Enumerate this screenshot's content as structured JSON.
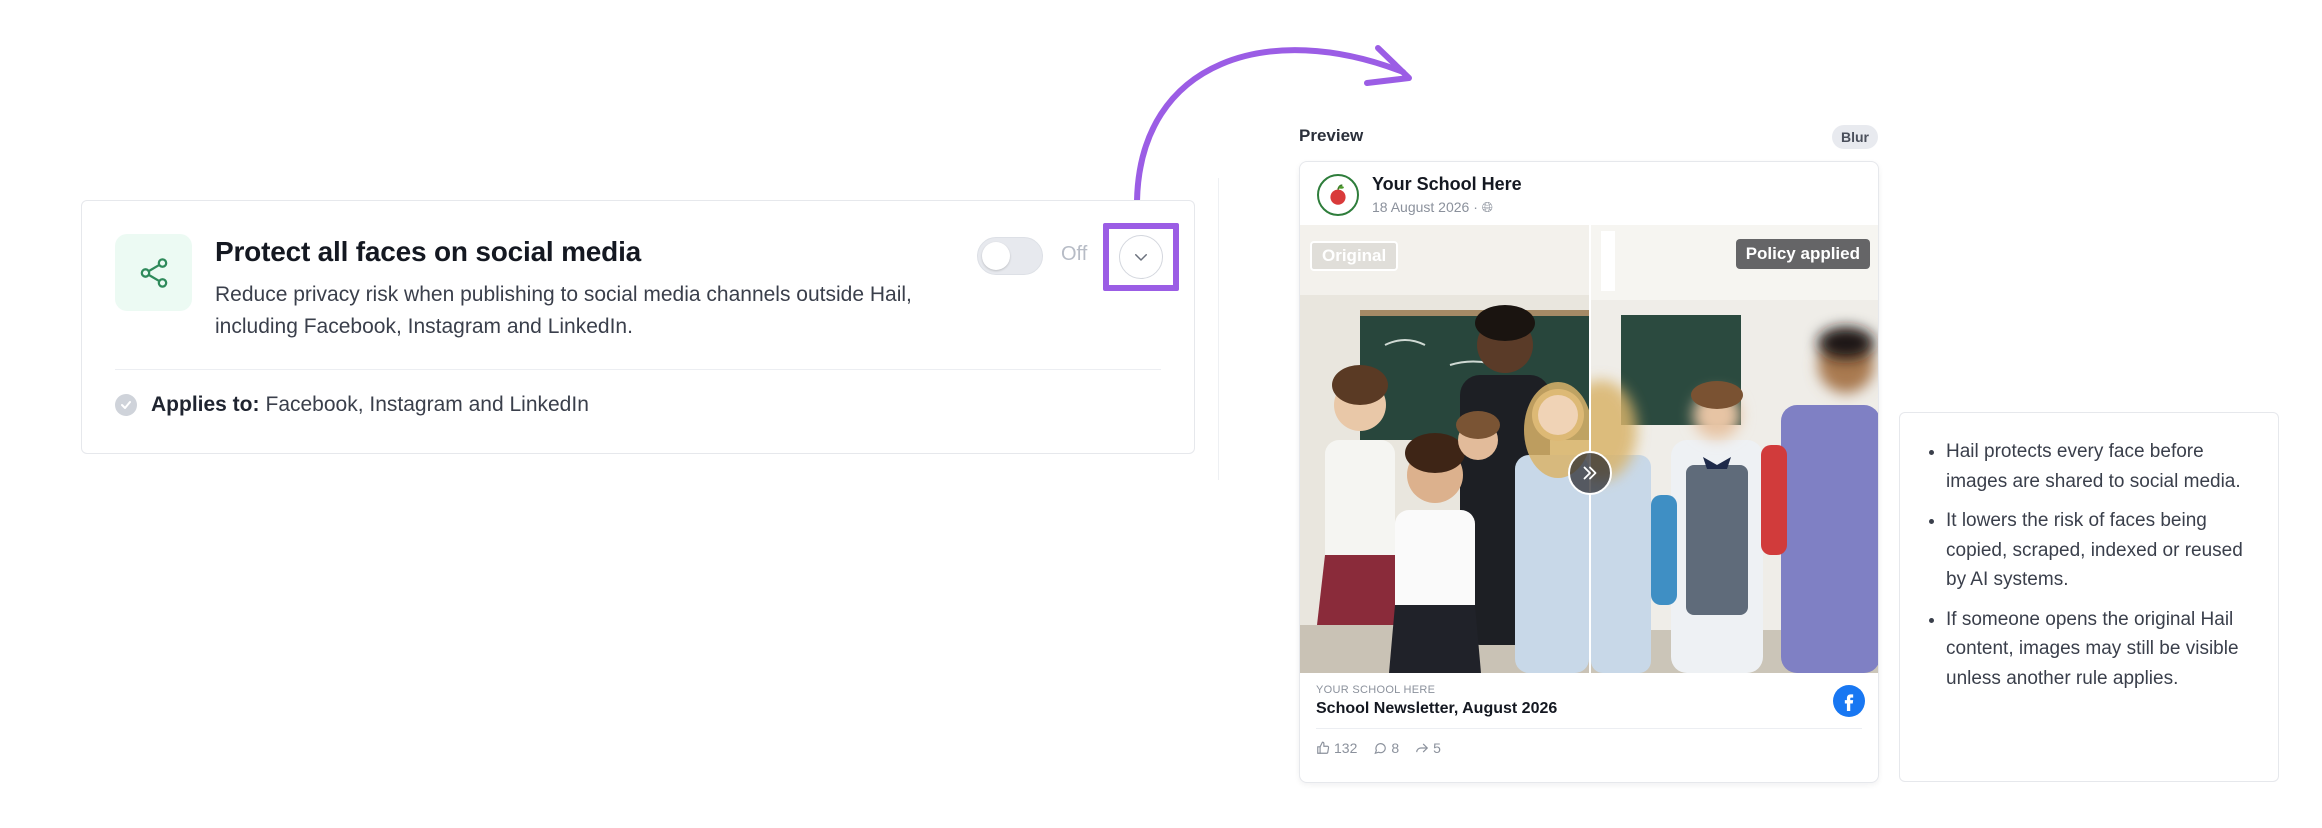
{
  "policy": {
    "title": "Protect all faces on social media",
    "description": "Reduce privacy risk when publishing to social media channels outside Hail, including Facebook, Instagram and LinkedIn.",
    "toggle_state": "Off",
    "toggle_on": false,
    "applies_label": "Applies to:",
    "applies_value": "Facebook, Instagram and LinkedIn",
    "icon": "share-icon",
    "accent_color": "#9b5de5"
  },
  "preview": {
    "label": "Preview",
    "mode_badge": "Blur",
    "post": {
      "author": "Your School Here",
      "date": "18 August 2026 · ",
      "original_tag": "Original",
      "policy_tag": "Policy applied",
      "link_domain": "YOUR SCHOOL HERE",
      "link_title": "School Newsletter, August 2026",
      "likes": "132",
      "comments": "8",
      "shares": "5",
      "platform_icon": "facebook-icon"
    }
  },
  "info": {
    "bullets": [
      "Hail protects every face before images are shared to social media.",
      "It lowers the risk of faces being copied, scraped, indexed or reused by AI systems.",
      "If someone opens the original Hail content, images may still be visible unless another rule applies."
    ]
  }
}
